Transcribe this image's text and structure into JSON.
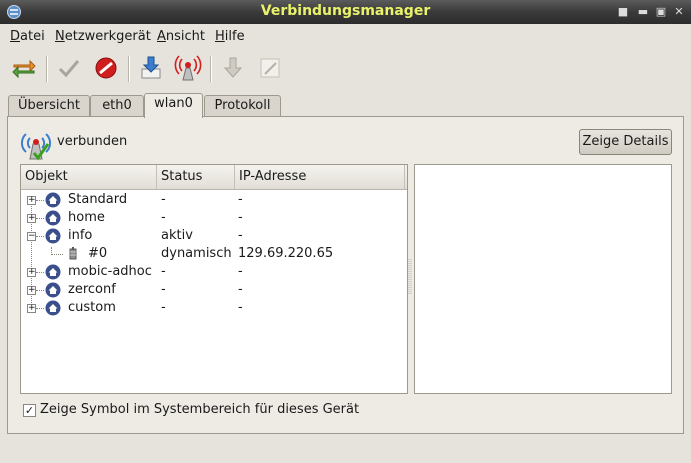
{
  "window": {
    "title": "Verbindungsmanager"
  },
  "menu": [
    {
      "underline": "D",
      "rest": "atei"
    },
    {
      "underline": "N",
      "rest": "etzwerkgerät"
    },
    {
      "underline": "A",
      "rest": "nsicht"
    },
    {
      "underline": "H",
      "rest": "ilfe"
    }
  ],
  "tabs": [
    "Übersicht",
    "eth0",
    "wlan0",
    "Protokoll"
  ],
  "active_tab": "wlan0",
  "status": {
    "text": "verbunden"
  },
  "details_button": "Zeige Details",
  "table": {
    "headers": [
      "Objekt",
      "Status",
      "IP-Adresse"
    ],
    "rows": [
      {
        "name": "Standard",
        "status": "-",
        "ip": "-"
      },
      {
        "name": "home",
        "status": "-",
        "ip": "-"
      },
      {
        "name": "info",
        "status": "aktiv",
        "ip": "-"
      },
      {
        "name": "#0",
        "status": "dynamisch",
        "ip": "129.69.220.65"
      },
      {
        "name": "mobic-adhoc",
        "status": "-",
        "ip": "-"
      },
      {
        "name": "zerconf",
        "status": "-",
        "ip": "-"
      },
      {
        "name": "custom",
        "status": "-",
        "ip": "-"
      }
    ]
  },
  "checkbox": {
    "label": "Zeige Symbol im Systembereich für dieses Gerät",
    "checked": true,
    "mark": "✓"
  },
  "colors": {
    "title_text": "#e9f26a",
    "home_icon": "#3b4f8c"
  }
}
